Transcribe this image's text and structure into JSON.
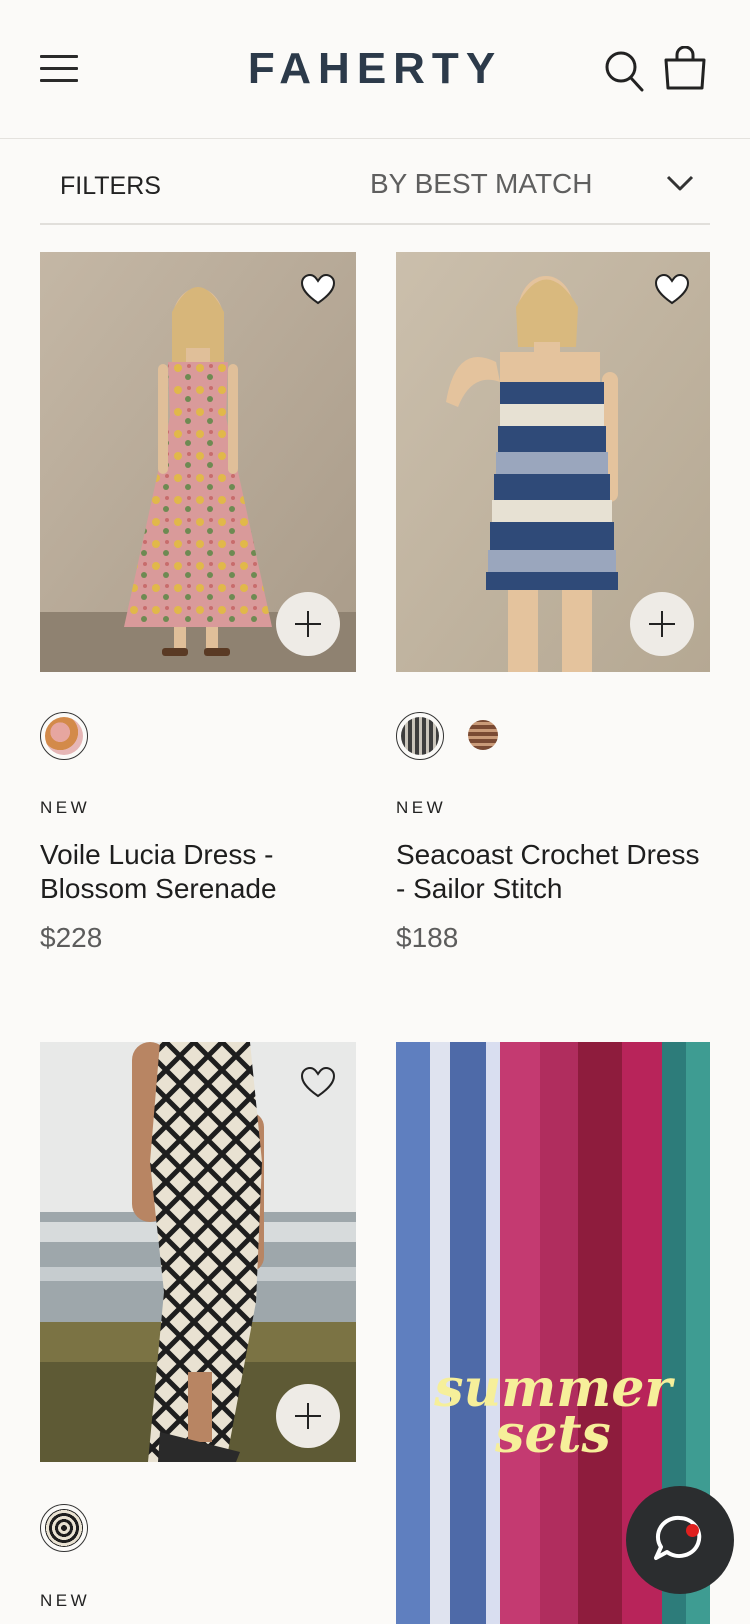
{
  "header": {
    "logo": "FAHERTY"
  },
  "toolbar": {
    "filters_label": "FILTERS",
    "sort_label": "BY BEST MATCH"
  },
  "products": [
    {
      "badge": "NEW",
      "name": "Voile Lucia Dress - Blossom Serenade",
      "price": "$228"
    },
    {
      "badge": "NEW",
      "name": "Seacoast Crochet Dress - Sailor Stitch",
      "price": "$188"
    },
    {
      "badge": "NEW",
      "name": "",
      "price": ""
    }
  ],
  "promo": {
    "line1": "summer",
    "line2": "sets"
  },
  "colors": {
    "background": "#fbfaf8",
    "logo": "#2c3a4a",
    "promo_text": "#f6ef9a",
    "chat_button": "#2b2d2f",
    "chat_dot": "#e0201f"
  },
  "icons": [
    "menu-icon",
    "search-icon",
    "shopping-bag-icon",
    "chevron-down-icon",
    "heart-icon",
    "plus-icon",
    "chat-icon"
  ]
}
